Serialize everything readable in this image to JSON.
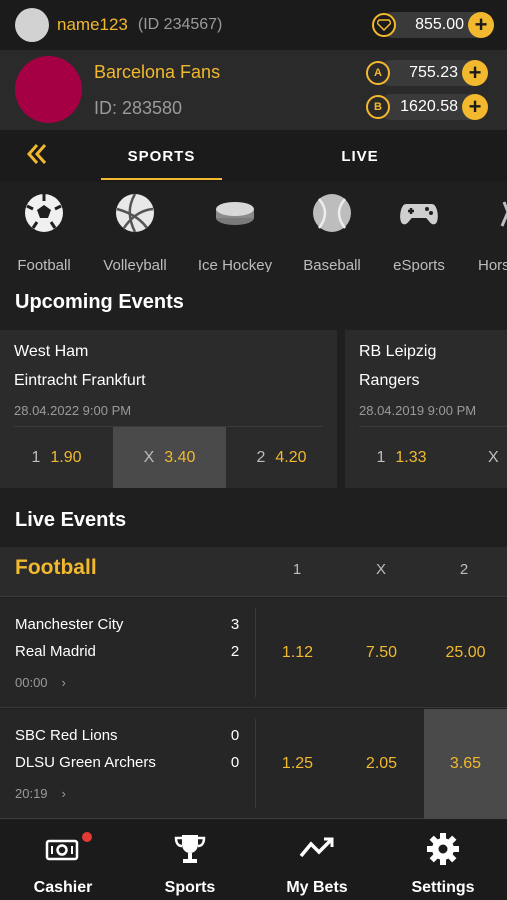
{
  "user": {
    "name": "name123",
    "id_label": "(ID 234567)",
    "balance": "855.00"
  },
  "club": {
    "name": "Barcelona Fans",
    "id_label": "ID: 283580",
    "balance_a": "755.23",
    "balance_b": "1620.58"
  },
  "colors": {
    "accent": "#f2b92e",
    "club": "#a50044",
    "notification": "#e53935"
  },
  "tabs": [
    {
      "label": "SPORTS",
      "active": true
    },
    {
      "label": "LIVE",
      "active": false
    }
  ],
  "sports": [
    {
      "label": "Football",
      "icon": "soccer-ball-icon"
    },
    {
      "label": "Volleyball",
      "icon": "volleyball-icon"
    },
    {
      "label": "Ice Hockey",
      "icon": "hockey-puck-icon"
    },
    {
      "label": "Baseball",
      "icon": "baseball-icon"
    },
    {
      "label": "eSports",
      "icon": "gamepad-icon"
    },
    {
      "label": "Hors",
      "icon": "horse-icon"
    }
  ],
  "upcoming": {
    "title": "Upcoming Events",
    "events": [
      {
        "home": "West Ham",
        "away": "Eintracht Frankfurt",
        "date": "28.04.2022  9:00 PM",
        "odds": [
          {
            "k": "1",
            "v": "1.90"
          },
          {
            "k": "X",
            "v": "3.40"
          },
          {
            "k": "2",
            "v": "4.20"
          }
        ]
      },
      {
        "home": "RB Leipzig",
        "away": "Rangers",
        "date": "28.04.2019  9:00 PM",
        "odds": [
          {
            "k": "1",
            "v": "1.33"
          },
          {
            "k": "X",
            "v": ""
          }
        ]
      }
    ]
  },
  "live": {
    "title": "Live Events",
    "sport": "Football",
    "columns": [
      "1",
      "X",
      "2"
    ],
    "matches": [
      {
        "home": "Manchester City",
        "home_score": "3",
        "away": "Real Madrid",
        "away_score": "2",
        "time": "00:00",
        "odds": [
          "1.12",
          "7.50",
          "25.00"
        ]
      },
      {
        "home": "SBC Red Lions",
        "home_score": "0",
        "away": "DLSU Green Archers",
        "away_score": "0",
        "time": "20:19",
        "odds": [
          "1.25",
          "2.05",
          "3.65"
        ]
      }
    ]
  },
  "nav": [
    {
      "label": "Cashier",
      "icon": "cashier-icon"
    },
    {
      "label": "Sports",
      "icon": "trophy-icon"
    },
    {
      "label": "My Bets",
      "icon": "trend-icon"
    },
    {
      "label": "Settings",
      "icon": "gear-icon"
    }
  ]
}
